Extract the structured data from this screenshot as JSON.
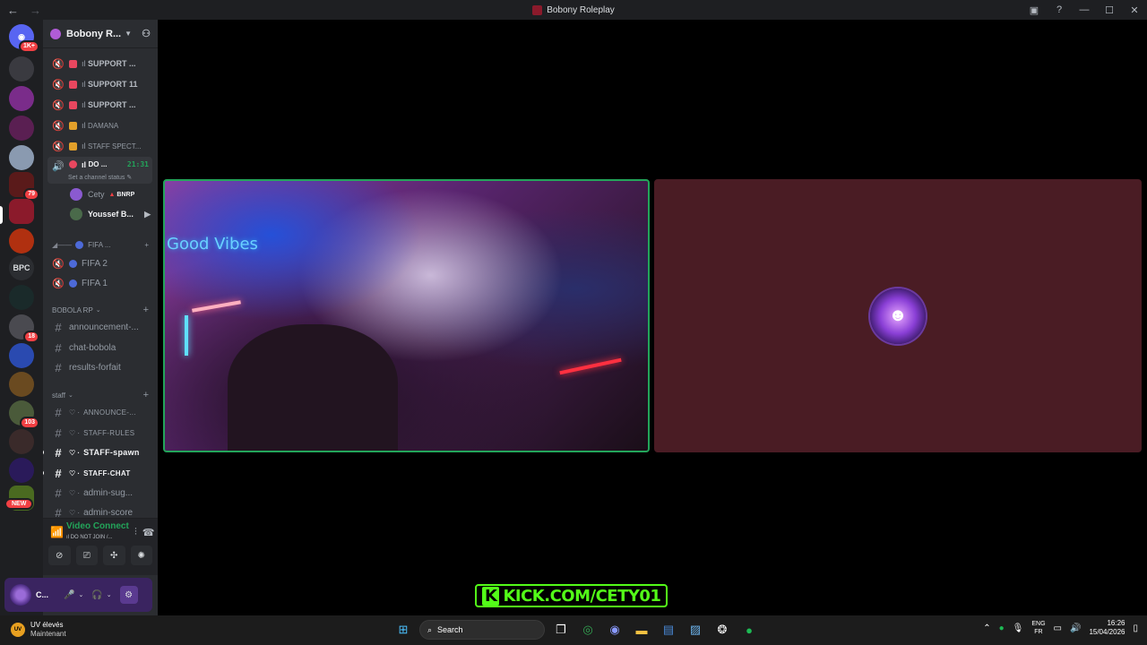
{
  "window": {
    "title": "Bobony Roleplay"
  },
  "guild_badges": {
    "home": "1K+",
    "g8": "79",
    "g13": "18",
    "g16": "103",
    "new": "NEW",
    "bpc": "BPC"
  },
  "server": {
    "name": "Bobony R..."
  },
  "voice_channels": [
    {
      "label": "SUPPORT ...",
      "prefix": "ıl",
      "emoji": "sos"
    },
    {
      "label": "SUPPORT 11",
      "prefix": "ıl",
      "emoji": "sos"
    },
    {
      "label": "SUPPORT ...",
      "prefix": "ıl",
      "emoji": "sos"
    },
    {
      "label": "DAMANA",
      "prefix": "ıl",
      "emoji": "gift"
    },
    {
      "label": "STAFF SPECT...",
      "prefix": "ıl",
      "emoji": "gift"
    }
  ],
  "active_channel": {
    "label": "DO ...",
    "prefix": "ıl",
    "time": "21:31",
    "status": "Set a channel status"
  },
  "voice_users": [
    {
      "name": "Cety",
      "tag": "BNRP"
    },
    {
      "name": "Youssef B..."
    }
  ],
  "fifa": {
    "category": "FIFA ...",
    "channels": [
      "FIFA 2",
      "FIFA 1"
    ]
  },
  "categories": {
    "bobola": "BOBOLA RP",
    "staff": "staff"
  },
  "text_channels_bobola": [
    "announcement-...",
    "chat-bobola",
    "results-forfait"
  ],
  "text_channels_staff": [
    {
      "label": "ANNOUNCE-...",
      "unread": false
    },
    {
      "label": "STAFF-RULES",
      "unread": false
    },
    {
      "label": "STAFF-spawn",
      "unread": true
    },
    {
      "label": "STAFF-CHAT",
      "unread": true
    },
    {
      "label": "admin-sug...",
      "unread": false
    },
    {
      "label": "admin-score",
      "unread": false
    }
  ],
  "rtc": {
    "status": "Video Connected",
    "channel": "ıl DO NOT JOIN /..."
  },
  "user": {
    "name": "C..."
  },
  "stream": {
    "kick_label": "KICK.COM/CETY01"
  },
  "taskbar": {
    "weather_title": "UV élevés",
    "weather_sub": "Maintenant",
    "search_placeholder": "Search",
    "lang1": "ENG",
    "lang2": "FR",
    "time": "16:26",
    "date": "15/04/2026"
  },
  "colors": {
    "accent_green": "#23a55a",
    "kick_green": "#53fc18",
    "danger": "#f23f43"
  }
}
